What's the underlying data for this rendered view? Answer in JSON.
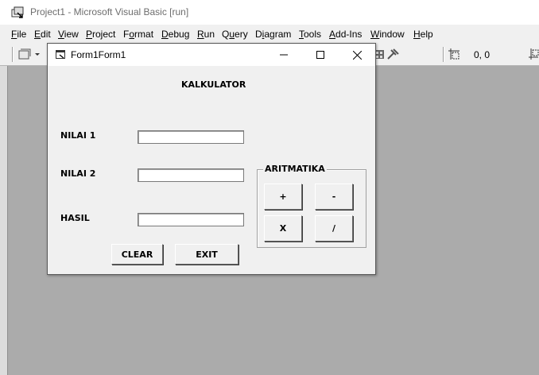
{
  "ide": {
    "title": "Project1 - Microsoft Visual Basic [run]",
    "menu": [
      {
        "pre": "",
        "ul": "F",
        "post": "ile"
      },
      {
        "pre": "",
        "ul": "E",
        "post": "dit"
      },
      {
        "pre": "",
        "ul": "V",
        "post": "iew"
      },
      {
        "pre": "",
        "ul": "P",
        "post": "roject"
      },
      {
        "pre": "F",
        "ul": "o",
        "post": "rmat"
      },
      {
        "pre": "",
        "ul": "D",
        "post": "ebug"
      },
      {
        "pre": "",
        "ul": "R",
        "post": "un"
      },
      {
        "pre": "Q",
        "ul": "u",
        "post": "ery"
      },
      {
        "pre": "D",
        "ul": "i",
        "post": "agram"
      },
      {
        "pre": "",
        "ul": "T",
        "post": "ools"
      },
      {
        "pre": "",
        "ul": "A",
        "post": "dd-Ins"
      },
      {
        "pre": "",
        "ul": "W",
        "post": "indow"
      },
      {
        "pre": "",
        "ul": "H",
        "post": "elp"
      }
    ],
    "coords": "0, 0"
  },
  "form": {
    "title": "Form1Form1",
    "heading": "KALKULATOR",
    "labels": {
      "nilai1": "NILAI 1",
      "nilai2": "NILAI 2",
      "hasil": "HASIL"
    },
    "inputs": {
      "nilai1": "",
      "nilai2": "",
      "hasil": ""
    },
    "group": {
      "title": "ARITMATIKA",
      "buttons": {
        "add": "+",
        "subtract": "-",
        "multiply": "X",
        "divide": "/"
      }
    },
    "buttons": {
      "clear": "CLEAR",
      "exit": "EXIT"
    }
  },
  "colors": {
    "ide_background": "#ababab",
    "control_face": "#f0f0f0"
  }
}
